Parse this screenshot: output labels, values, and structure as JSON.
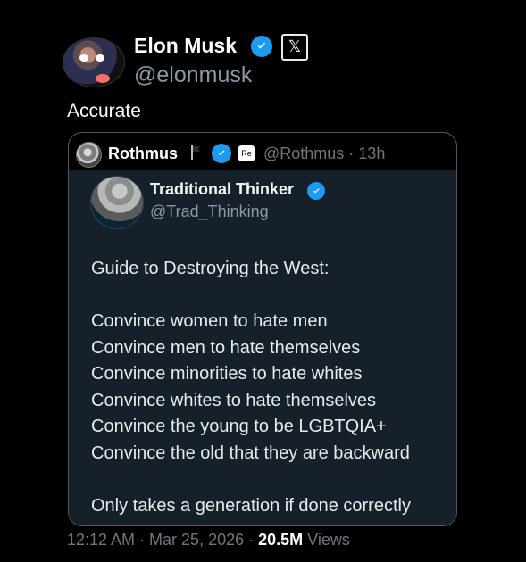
{
  "header": {
    "name": "Elon Musk",
    "handle": "@elonmusk",
    "x_badge": "𝕏"
  },
  "tweet": {
    "text": "Accurate"
  },
  "quote": {
    "name": "Rothmus",
    "badge_text": "Re",
    "handle_time": "@Rothmus · 13h"
  },
  "screenshot": {
    "name": "Traditional Thinker",
    "handle": "@Trad_Thinking",
    "lines": [
      "Guide to Destroying the West:",
      "Convince women to hate men",
      "Convince men to hate themselves",
      "Convince minorities to hate whites",
      "Convince whites to hate themselves",
      "Convince the young to be LGBTQIA+",
      "Convince the old that they are backward",
      "Only takes a generation if done correctly"
    ]
  },
  "footer": {
    "timestamp": "12:12 AM · Mar 25, 2026 · ",
    "views_count": "20.5M",
    "views_label": " Views"
  }
}
